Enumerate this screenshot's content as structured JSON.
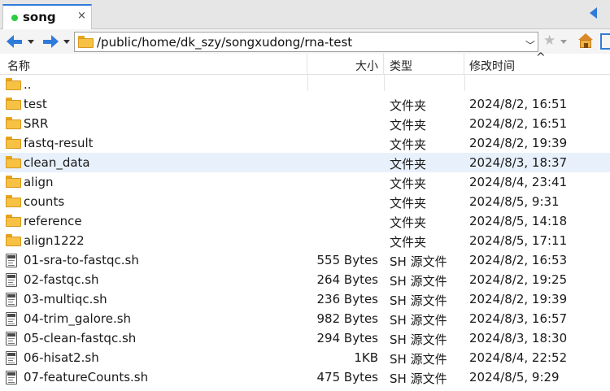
{
  "tab": {
    "label": "song",
    "close": "×",
    "status_color": "#2ecc40"
  },
  "address": {
    "path": "/public/home/dk_szy/songxudong/rna-test",
    "dropdown": "﹀"
  },
  "toolbar": {
    "star": "★"
  },
  "columns": {
    "name": "名称",
    "size": "大小",
    "type": "类型",
    "modified": "修改时间",
    "sort_indicator": "^"
  },
  "files": [
    {
      "name": "..",
      "size": "",
      "type": "",
      "modified": "",
      "icon": "folder-icon"
    },
    {
      "name": "test",
      "size": "",
      "type": "文件夹",
      "modified": "2024/8/2, 16:51",
      "icon": "folder-icon"
    },
    {
      "name": "SRR",
      "size": "",
      "type": "文件夹",
      "modified": "2024/8/2, 16:51",
      "icon": "folder-icon"
    },
    {
      "name": "fastq-result",
      "size": "",
      "type": "文件夹",
      "modified": "2024/8/2, 19:39",
      "icon": "folder-icon"
    },
    {
      "name": "clean_data",
      "size": "",
      "type": "文件夹",
      "modified": "2024/8/3, 18:37",
      "icon": "folder-icon"
    },
    {
      "name": "align",
      "size": "",
      "type": "文件夹",
      "modified": "2024/8/4, 23:41",
      "icon": "folder-icon"
    },
    {
      "name": "counts",
      "size": "",
      "type": "文件夹",
      "modified": "2024/8/5, 9:31",
      "icon": "folder-icon"
    },
    {
      "name": "reference",
      "size": "",
      "type": "文件夹",
      "modified": "2024/8/5, 14:18",
      "icon": "folder-icon"
    },
    {
      "name": "align1222",
      "size": "",
      "type": "文件夹",
      "modified": "2024/8/5, 17:11",
      "icon": "folder-icon"
    },
    {
      "name": "01-sra-to-fastqc.sh",
      "size": "555 Bytes",
      "type": "SH 源文件",
      "modified": "2024/8/2, 16:53",
      "icon": "script-file-icon"
    },
    {
      "name": "02-fastqc.sh",
      "size": "264 Bytes",
      "type": "SH 源文件",
      "modified": "2024/8/2, 19:25",
      "icon": "script-file-icon"
    },
    {
      "name": "03-multiqc.sh",
      "size": "236 Bytes",
      "type": "SH 源文件",
      "modified": "2024/8/2, 19:39",
      "icon": "script-file-icon"
    },
    {
      "name": "04-trim_galore.sh",
      "size": "982 Bytes",
      "type": "SH 源文件",
      "modified": "2024/8/3, 16:57",
      "icon": "script-file-icon"
    },
    {
      "name": "05-clean-fastqc.sh",
      "size": "294 Bytes",
      "type": "SH 源文件",
      "modified": "2024/8/3, 18:30",
      "icon": "script-file-icon"
    },
    {
      "name": "06-hisat2.sh",
      "size": "1KB",
      "type": "SH 源文件",
      "modified": "2024/8/4, 22:52",
      "icon": "script-file-icon"
    },
    {
      "name": "07-featureCounts.sh",
      "size": "475 Bytes",
      "type": "SH 源文件",
      "modified": "2024/8/5, 9:29",
      "icon": "script-file-icon"
    }
  ],
  "selected_index": 4,
  "colors": {
    "accent": "#2f7bd9",
    "folder": "#f7c244",
    "selected_row": "#e8f1fb"
  }
}
